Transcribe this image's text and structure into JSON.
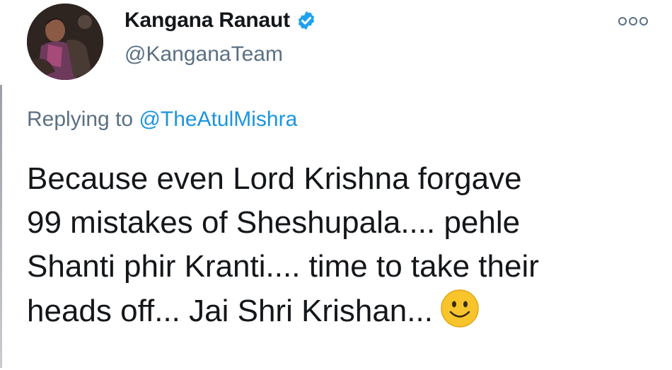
{
  "author": {
    "display_name": "Kangana Ranaut",
    "handle": "@KanganaTeam",
    "verified_icon": "verified-badge-icon",
    "avatar": "profile-avatar"
  },
  "more_icon": "more-options-icon",
  "reply": {
    "prefix": "Replying to",
    "mention": "@TheAtulMishra"
  },
  "tweet": {
    "lines": [
      "Because even Lord Krishna forgave",
      "99 mistakes of Sheshupala.... pehle",
      "Shanti phir Kranti.... time to take their",
      "heads off... Jai Shri Krishan..."
    ],
    "emoji": "smiley-icon"
  },
  "colors": {
    "text": "#14171a",
    "secondary": "#5b7083",
    "link": "#1b95e0",
    "verified": "#1da1f2",
    "emoji": "#f7c52b"
  }
}
